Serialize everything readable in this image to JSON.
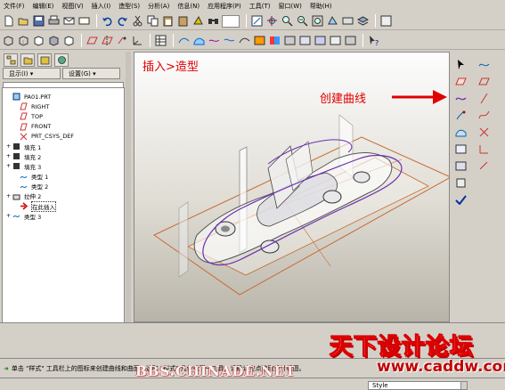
{
  "menu": [
    "文件(F)",
    "编辑(E)",
    "视图(V)",
    "插入(I)",
    "造型(S)",
    "分析(A)",
    "信息(N)",
    "应用程序(P)",
    "工具(T)",
    "窗口(W)",
    "帮助(H)"
  ],
  "left_panel": {
    "show_label": "显示(I) ▾",
    "settings_label": "设置(G) ▾",
    "tree": [
      {
        "label": "PA01.PRT",
        "icon": "part-icon",
        "indent": 0,
        "expand": ""
      },
      {
        "label": "RIGHT",
        "icon": "datum-plane-icon",
        "indent": 1,
        "expand": ""
      },
      {
        "label": "TOP",
        "icon": "datum-plane-icon",
        "indent": 1,
        "expand": ""
      },
      {
        "label": "FRONT",
        "icon": "datum-plane-icon",
        "indent": 1,
        "expand": ""
      },
      {
        "label": "PRT_CSYS_DEF",
        "icon": "csys-icon",
        "indent": 1,
        "expand": ""
      },
      {
        "label": "填充 1",
        "icon": "fill-icon",
        "indent": 0,
        "expand": "+"
      },
      {
        "label": "填充 2",
        "icon": "fill-icon",
        "indent": 0,
        "expand": "+"
      },
      {
        "label": "填充 3",
        "icon": "fill-icon",
        "indent": 0,
        "expand": "+"
      },
      {
        "label": "类型 1",
        "icon": "style-icon",
        "indent": 1,
        "expand": ""
      },
      {
        "label": "类型 2",
        "icon": "style-icon",
        "indent": 1,
        "expand": ""
      },
      {
        "label": "拉伸 2",
        "icon": "extrude-icon",
        "indent": 0,
        "expand": "+"
      },
      {
        "label": "在此插入",
        "icon": "insert-here-icon",
        "indent": 1,
        "expand": ""
      },
      {
        "label": "类型 3",
        "icon": "style-icon",
        "indent": 0,
        "expand": "+"
      }
    ]
  },
  "annotations": {
    "insert_style": "插入>造型",
    "create_curve": "创建曲线"
  },
  "status_message": "单击 \"样式\" 工具栏上的图标来创建曲线和曲面。选取 \"样式\" 几何或下一工具。请确认定点选取设计视图。",
  "style_selector": "Style",
  "watermark": {
    "forum_name": "天下设计论坛",
    "site": "www.caddw.com",
    "bbs": "BBS.CHINADE.NET"
  },
  "colors": {
    "annotation_red": "#e00000",
    "arrow_red": "#e00000",
    "curve_purple": "#6a2fb0",
    "curve_orange": "#c86a30"
  }
}
